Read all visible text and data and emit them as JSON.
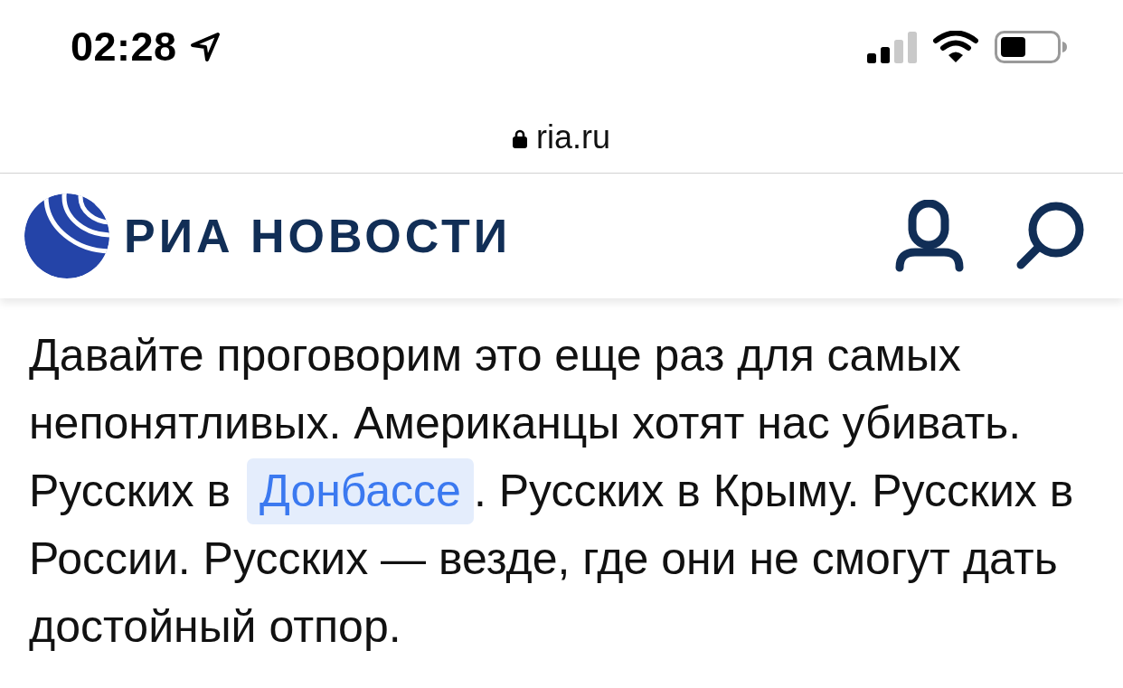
{
  "status_bar": {
    "time": "02:28"
  },
  "address_bar": {
    "url": "ria.ru"
  },
  "site_header": {
    "logo_text": "РИА НОВОСТИ"
  },
  "article": {
    "paragraph": [
      {
        "kind": "text",
        "text": "Давайте проговорим это еще раз для самых непонятливых. Американцы хотят нас убивать. Русских в "
      },
      {
        "kind": "link",
        "text": "Донбассе"
      },
      {
        "kind": "text",
        "text": ". Русских в Крыму. Русских в России. Русских — везде, где они не смогут дать достойный отпор."
      }
    ]
  }
}
